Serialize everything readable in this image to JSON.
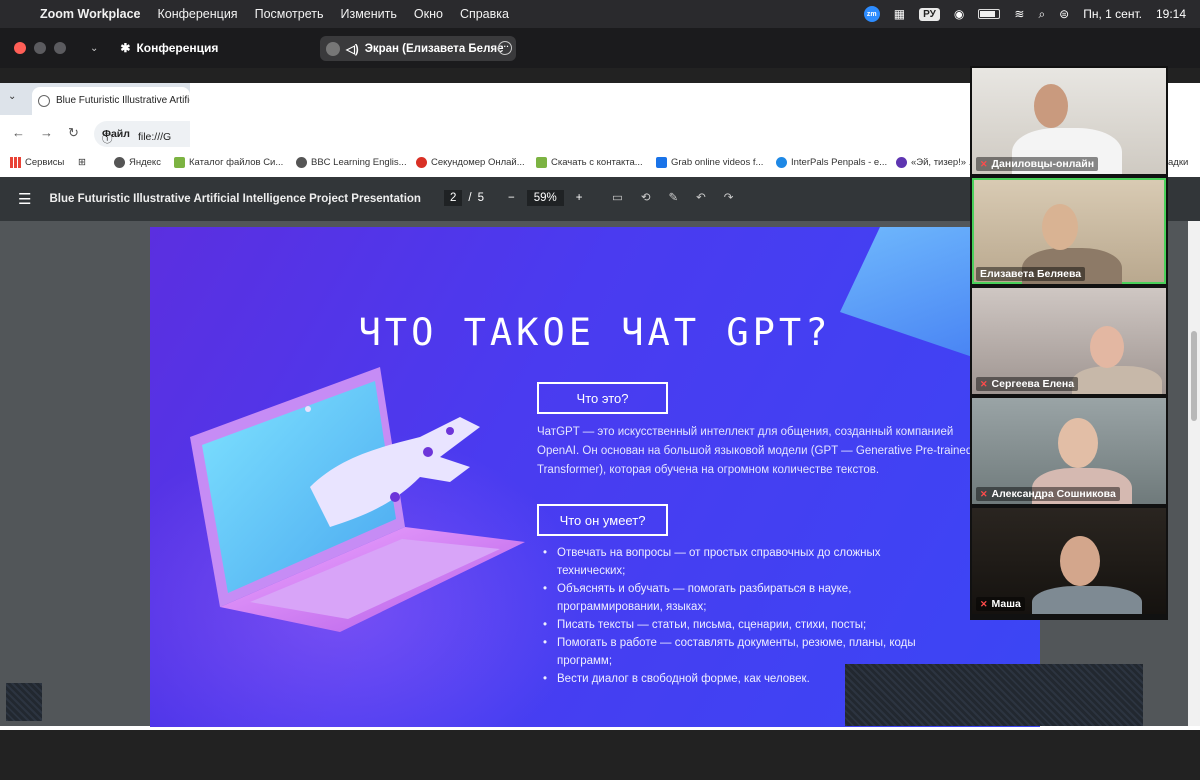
{
  "menubar": {
    "app": "Zoom Workplace",
    "items": [
      "Конференция",
      "Посмотреть",
      "Изменить",
      "Окно",
      "Справка"
    ],
    "zm": "zm",
    "keyboard": "РУ",
    "datetime_date": "Пн, 1 сент.",
    "datetime_time": "19:14"
  },
  "zoom_toolbar": {
    "meeting_label": "Конференция",
    "share_pill": "Экран (Елизавета Беляе"
  },
  "browser": {
    "tab_title": "Blue Futuristic Illustrative Artific",
    "omnibox_scheme": "Файл",
    "omnibox_url": "file:///G",
    "bookmarks": [
      {
        "label": "Сервисы",
        "color": "#e94235"
      },
      {
        "label": "Яндекс",
        "color": "#555555"
      },
      {
        "label": "Каталог файлов Си...",
        "color": "#7cb342"
      },
      {
        "label": "BBC Learning Englis...",
        "color": "#555555"
      },
      {
        "label": "Секундомер Онлай...",
        "color": "#d93025"
      },
      {
        "label": "Скачать с контакта...",
        "color": "#7cb342"
      },
      {
        "label": "Grab online videos f...",
        "color": "#1a73e8"
      },
      {
        "label": "InterPals Penpals - e...",
        "color": "#1e88e5"
      },
      {
        "label": "«Эй, тизер!» ...",
        "color": "#5e35b1"
      },
      {
        "label": "адки",
        "color": "#ffffff"
      }
    ]
  },
  "pdf": {
    "title": "Blue Futuristic Illustrative Artificial Intelligence Project Presentation",
    "page_current": "2",
    "page_sep": "/",
    "page_total": "5",
    "zoom_minus": "−",
    "zoom": "59%",
    "zoom_plus": "+"
  },
  "slide": {
    "heading": "ЧТО ТАКОЕ ЧАТ GPT?",
    "box1": "Что это?",
    "paragraph": "ЧатGPT — это искусственный интеллект для общения, созданный компанией OpenAI. Он основан на большой языковой модели (GPT — Generative Pre-trained Transformer), которая обучена на огромном количестве текстов.",
    "box2": "Что он умеет?",
    "bullets": [
      "Отвечать на вопросы — от простых справочных до сложных технических;",
      "Объяснять и обучать — помогать разбираться в науке, программировании, языках;",
      "Писать тексты — статьи, письма, сценарии, стихи, посты;",
      "Помогать в работе — составлять документы, резюме, планы, коды программ;",
      "Вести диалог в свободной форме, как человек."
    ]
  },
  "participants": [
    {
      "name": "Даниловцы-онлайн",
      "muted": true
    },
    {
      "name": "Елизавета Беляева",
      "muted": false,
      "active": true
    },
    {
      "name": "Сергеева Елена",
      "muted": true
    },
    {
      "name": "Александра Сошникова",
      "muted": true
    },
    {
      "name": "Маша",
      "muted": true
    }
  ]
}
